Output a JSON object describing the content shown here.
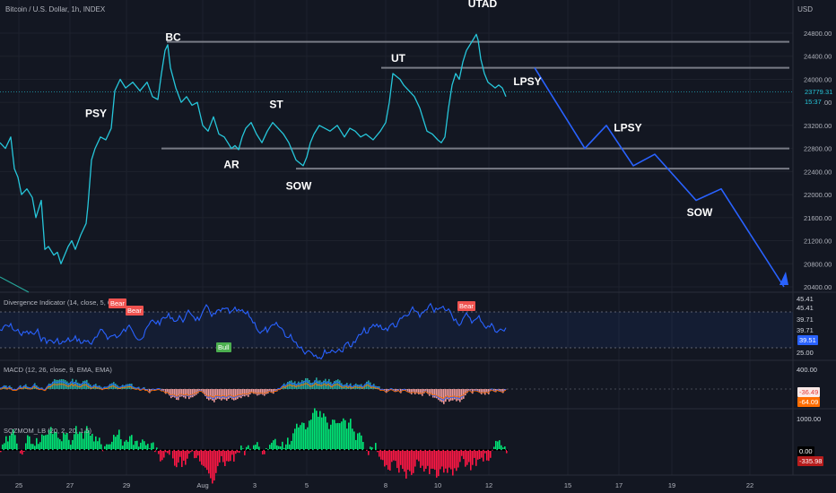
{
  "header": {
    "symbol": "Bitcoin / U.S. Dollar, 1h, INDEX",
    "currency": "USD"
  },
  "chart_data": {
    "type": "line",
    "title": "Bitcoin / U.S. Dollar, 1h, INDEX",
    "x_ticks": [
      "25",
      "27",
      "29",
      "Aug",
      "3",
      "5",
      "8",
      "10",
      "12",
      "15",
      "17",
      "19",
      "22"
    ],
    "y_ticks": [
      20400,
      20800,
      21200,
      21600,
      22000,
      22400,
      22800,
      23200,
      23600,
      24000,
      24400,
      24800
    ],
    "ylim": [
      20350,
      25000
    ],
    "grid": true,
    "series": [
      {
        "points": [
          [
            0,
            22900
          ],
          [
            6,
            22800
          ],
          [
            12,
            23000
          ],
          [
            16,
            22450
          ],
          [
            20,
            22300
          ],
          [
            24,
            22000
          ],
          [
            30,
            22100
          ],
          [
            36,
            21950
          ],
          [
            40,
            21600
          ],
          [
            46,
            21900
          ],
          [
            50,
            21050
          ],
          [
            54,
            21100
          ],
          [
            60,
            20950
          ],
          [
            64,
            21000
          ],
          [
            68,
            20800
          ],
          [
            72,
            20950
          ],
          [
            76,
            21100
          ],
          [
            80,
            21200
          ],
          [
            84,
            21050
          ],
          [
            90,
            21300
          ],
          [
            96,
            21500
          ],
          [
            98,
            21800
          ],
          [
            102,
            22600
          ],
          [
            106,
            22800
          ],
          [
            112,
            23000
          ],
          [
            118,
            22950
          ],
          [
            124,
            23150
          ],
          [
            128,
            23800
          ],
          [
            134,
            24000
          ],
          [
            140,
            23850
          ],
          [
            148,
            23950
          ],
          [
            156,
            23800
          ],
          [
            164,
            23950
          ],
          [
            170,
            23700
          ],
          [
            176,
            23650
          ],
          [
            180,
            24100
          ],
          [
            184,
            24500
          ],
          [
            187,
            24600
          ],
          [
            190,
            24200
          ],
          [
            196,
            23850
          ],
          [
            202,
            23600
          ],
          [
            208,
            23700
          ],
          [
            214,
            23550
          ],
          [
            220,
            23600
          ],
          [
            226,
            23200
          ],
          [
            232,
            23100
          ],
          [
            238,
            23350
          ],
          [
            244,
            23050
          ],
          [
            250,
            23000
          ],
          [
            254,
            22900
          ],
          [
            258,
            22800
          ],
          [
            262,
            22850
          ],
          [
            266,
            22780
          ],
          [
            270,
            23000
          ],
          [
            274,
            23150
          ],
          [
            280,
            23250
          ],
          [
            286,
            23050
          ],
          [
            292,
            22900
          ],
          [
            298,
            23100
          ],
          [
            304,
            23250
          ],
          [
            310,
            23150
          ],
          [
            316,
            23050
          ],
          [
            322,
            22900
          ],
          [
            326,
            22750
          ],
          [
            330,
            22600
          ],
          [
            334,
            22550
          ],
          [
            338,
            22500
          ],
          [
            342,
            22650
          ],
          [
            346,
            22900
          ],
          [
            350,
            23050
          ],
          [
            356,
            23200
          ],
          [
            362,
            23150
          ],
          [
            368,
            23100
          ],
          [
            376,
            23200
          ],
          [
            384,
            23000
          ],
          [
            390,
            23150
          ],
          [
            396,
            23100
          ],
          [
            402,
            23000
          ],
          [
            408,
            23050
          ],
          [
            416,
            22950
          ],
          [
            424,
            23100
          ],
          [
            430,
            23250
          ],
          [
            434,
            23600
          ],
          [
            438,
            24100
          ],
          [
            442,
            24050
          ],
          [
            446,
            24000
          ],
          [
            450,
            23900
          ],
          [
            456,
            23800
          ],
          [
            462,
            23700
          ],
          [
            468,
            23500
          ],
          [
            472,
            23300
          ],
          [
            476,
            23100
          ],
          [
            482,
            23050
          ],
          [
            488,
            22950
          ],
          [
            492,
            22900
          ],
          [
            496,
            23000
          ],
          [
            500,
            23500
          ],
          [
            504,
            23900
          ],
          [
            508,
            24100
          ],
          [
            512,
            24000
          ],
          [
            516,
            24300
          ],
          [
            520,
            24500
          ],
          [
            524,
            24600
          ],
          [
            528,
            24700
          ],
          [
            531,
            24780
          ],
          [
            533,
            24680
          ],
          [
            536,
            24350
          ],
          [
            540,
            24100
          ],
          [
            544,
            23950
          ],
          [
            548,
            23900
          ],
          [
            552,
            23850
          ],
          [
            556,
            23900
          ],
          [
            560,
            23850
          ],
          [
            564,
            23700
          ]
        ],
        "color": "#26c6da"
      },
      {
        "points": [
          [
            596,
            24200
          ],
          [
            652,
            22800
          ],
          [
            676,
            23200
          ],
          [
            706,
            22500
          ],
          [
            730,
            22700
          ],
          [
            776,
            21900
          ],
          [
            804,
            22100
          ],
          [
            874,
            20400
          ]
        ],
        "color": "#2962ff"
      }
    ],
    "levels": [
      {
        "from": 186,
        "to": 880,
        "y": 24650
      },
      {
        "from": 425,
        "to": 880,
        "y": 24200
      },
      {
        "from": 180,
        "to": 880,
        "y": 22800
      },
      {
        "from": 330,
        "to": 880,
        "y": 22450
      }
    ],
    "annotations": [
      {
        "text": "BC",
        "x": 193,
        "y": 24670
      },
      {
        "text": "UTAD",
        "x": 538,
        "y": 25250
      },
      {
        "text": "UT",
        "x": 444,
        "y": 24300
      },
      {
        "text": "LPSY",
        "x": 588,
        "y": 23900
      },
      {
        "text": "PSY",
        "x": 107,
        "y": 23350
      },
      {
        "text": "ST",
        "x": 308,
        "y": 23500
      },
      {
        "text": "LPSY",
        "x": 700,
        "y": 23100
      },
      {
        "text": "AR",
        "x": 258,
        "y": 22460
      },
      {
        "text": "SOW",
        "x": 333,
        "y": 22090
      },
      {
        "text": "SOW",
        "x": 780,
        "y": 21630
      }
    ],
    "price_tag": {
      "value": "23779.31",
      "countdown": "15:37"
    }
  },
  "indicators": {
    "divergence": {
      "title": "Divergence Indicator (14, close, 5, 60, 5)",
      "labels": {
        "top": "45.41",
        "top2": "45.41",
        "mid": "39.71",
        "mid2": "39.71",
        "cur": "39.51",
        "bottom": "25.00"
      },
      "signals": {
        "bear": "Bear",
        "bull": "Bull"
      }
    },
    "macd": {
      "title": "MACD (12, 26, close, 9, EMA, EMA)",
      "labels": {
        "top": "400.00",
        "a": "-36.49",
        "b": "-64.09"
      }
    },
    "sqzmom": {
      "title": "SQZMOM_LB (20, 2, 20, 1.5)",
      "labels": {
        "top": "1000.00",
        "zero": "0.00",
        "cur": "-335.98"
      }
    }
  }
}
